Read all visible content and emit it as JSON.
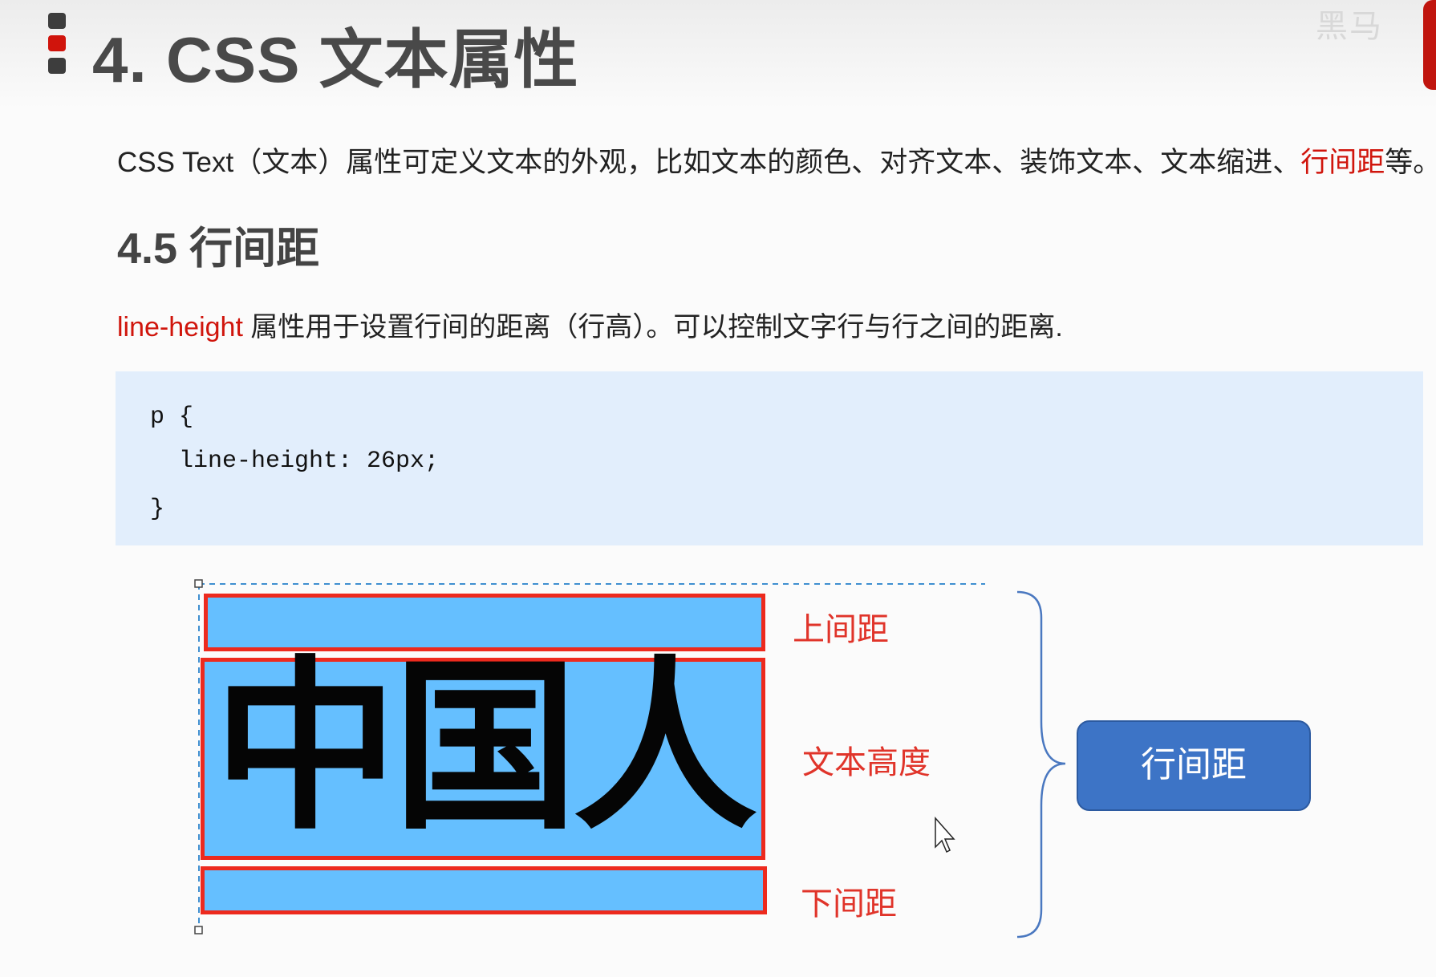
{
  "header": {
    "title": "4. CSS 文本属性"
  },
  "intro": {
    "prefix": "CSS Text（文本）属性可定义文本的外观，比如文本的颜色、对齐文本、装饰文本、文本缩进、",
    "highlight": "行间距",
    "suffix": "等。"
  },
  "section": {
    "heading": "4.5 行间距"
  },
  "property_desc": {
    "highlight": "line-height",
    "rest": " 属性用于设置行间的距离（行高）。可以控制文字行与行之间的距离."
  },
  "code": {
    "lines": [
      "p {",
      "  line-height: 26px;",
      "}"
    ]
  },
  "diagram": {
    "glyph_text": "中国人",
    "labels": {
      "top_spacing": "上间距",
      "text_height": "文本高度",
      "bottom_spacing": "下间距"
    },
    "result_label": "行间距"
  },
  "colors": {
    "accent_red": "#d0150c",
    "box_blue": "#65bfff",
    "button_blue": "#3d74c6",
    "code_bg": "#e2eefc"
  },
  "icons": {
    "title_bullet": "bullet-bar-icon",
    "cursor": "mouse-pointer-icon"
  }
}
